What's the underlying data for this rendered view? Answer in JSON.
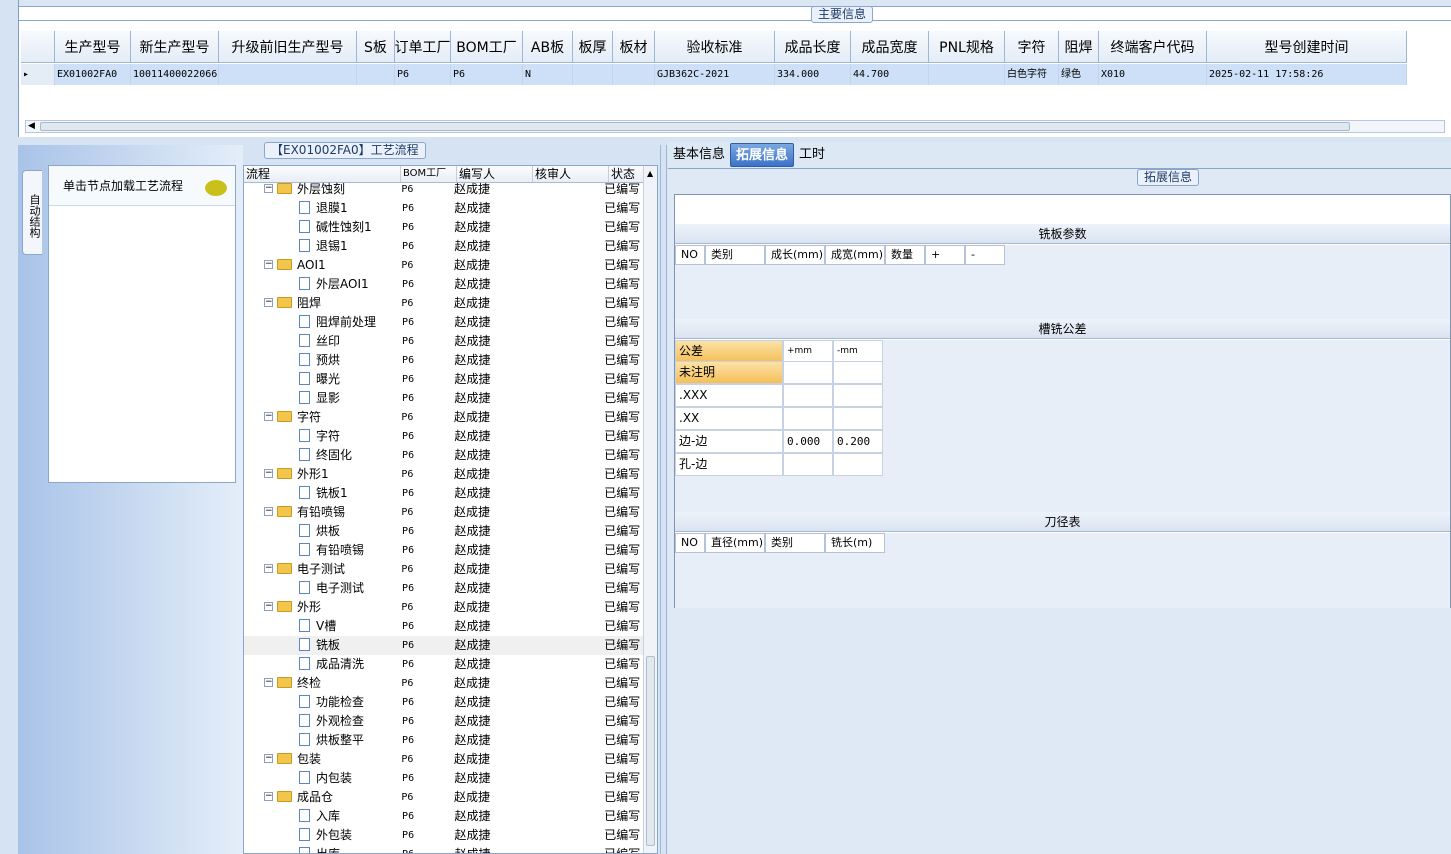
{
  "main_info": {
    "title": "主要信息",
    "columns": [
      "生产型号",
      "新生产型号",
      "升级前旧生产型号",
      "S板",
      "订单工厂",
      "BOM工厂",
      "AB板",
      "板厚",
      "板材",
      "验收标准",
      "成品长度",
      "成品宽度",
      "PNL规格",
      "字符",
      "阻焊",
      "终端客户代码",
      "型号创建时间"
    ],
    "row": [
      "EX01002FA0",
      "10011400022066",
      "",
      "",
      "P6",
      "P6",
      "N",
      "",
      "",
      "GJB362C-2021",
      "334.000",
      "44.700",
      "",
      "白色字符",
      "绿色",
      "X010",
      "2025-02-11 17:58:26"
    ]
  },
  "left_panel": {
    "side_tab": "自动结构",
    "hint": "单击节点加载工艺流程"
  },
  "process": {
    "title": "【EX01002FA0】工艺流程",
    "columns": [
      "流程",
      "BOM工厂",
      "编写人",
      "核审人",
      "状态"
    ],
    "rows": [
      {
        "name": "外层蚀刻",
        "level": 0,
        "bom": "P6",
        "writer": "赵成捷",
        "auditor": "",
        "status": "已编写"
      },
      {
        "name": "退膜1",
        "level": 1,
        "bom": "P6",
        "writer": "赵成捷",
        "auditor": "",
        "status": "已编写"
      },
      {
        "name": "碱性蚀刻1",
        "level": 1,
        "bom": "P6",
        "writer": "赵成捷",
        "auditor": "",
        "status": "已编写"
      },
      {
        "name": "退锡1",
        "level": 1,
        "bom": "P6",
        "writer": "赵成捷",
        "auditor": "",
        "status": "已编写"
      },
      {
        "name": "AOI1",
        "level": 0,
        "bom": "P6",
        "writer": "赵成捷",
        "auditor": "",
        "status": "已编写"
      },
      {
        "name": "外层AOI1",
        "level": 1,
        "bom": "P6",
        "writer": "赵成捷",
        "auditor": "",
        "status": "已编写"
      },
      {
        "name": "阻焊",
        "level": 0,
        "bom": "P6",
        "writer": "赵成捷",
        "auditor": "",
        "status": "已编写"
      },
      {
        "name": "阻焊前处理",
        "level": 1,
        "bom": "P6",
        "writer": "赵成捷",
        "auditor": "",
        "status": "已编写"
      },
      {
        "name": "丝印",
        "level": 1,
        "bom": "P6",
        "writer": "赵成捷",
        "auditor": "",
        "status": "已编写"
      },
      {
        "name": "预烘",
        "level": 1,
        "bom": "P6",
        "writer": "赵成捷",
        "auditor": "",
        "status": "已编写"
      },
      {
        "name": "曝光",
        "level": 1,
        "bom": "P6",
        "writer": "赵成捷",
        "auditor": "",
        "status": "已编写"
      },
      {
        "name": "显影",
        "level": 1,
        "bom": "P6",
        "writer": "赵成捷",
        "auditor": "",
        "status": "已编写"
      },
      {
        "name": "字符",
        "level": 0,
        "bom": "P6",
        "writer": "赵成捷",
        "auditor": "",
        "status": "已编写"
      },
      {
        "name": "字符",
        "level": 1,
        "bom": "P6",
        "writer": "赵成捷",
        "auditor": "",
        "status": "已编写"
      },
      {
        "name": "终固化",
        "level": 1,
        "bom": "P6",
        "writer": "赵成捷",
        "auditor": "",
        "status": "已编写"
      },
      {
        "name": "外形1",
        "level": 0,
        "bom": "P6",
        "writer": "赵成捷",
        "auditor": "",
        "status": "已编写"
      },
      {
        "name": "铣板1",
        "level": 1,
        "bom": "P6",
        "writer": "赵成捷",
        "auditor": "",
        "status": "已编写"
      },
      {
        "name": "有铅喷锡",
        "level": 0,
        "bom": "P6",
        "writer": "赵成捷",
        "auditor": "",
        "status": "已编写"
      },
      {
        "name": "烘板",
        "level": 1,
        "bom": "P6",
        "writer": "赵成捷",
        "auditor": "",
        "status": "已编写"
      },
      {
        "name": "有铅喷锡",
        "level": 1,
        "bom": "P6",
        "writer": "赵成捷",
        "auditor": "",
        "status": "已编写"
      },
      {
        "name": "电子测试",
        "level": 0,
        "bom": "P6",
        "writer": "赵成捷",
        "auditor": "",
        "status": "已编写"
      },
      {
        "name": "电子测试",
        "level": 1,
        "bom": "P6",
        "writer": "赵成捷",
        "auditor": "",
        "status": "已编写"
      },
      {
        "name": "外形",
        "level": 0,
        "bom": "P6",
        "writer": "赵成捷",
        "auditor": "",
        "status": "已编写"
      },
      {
        "name": "V槽",
        "level": 1,
        "bom": "P6",
        "writer": "赵成捷",
        "auditor": "",
        "status": "已编写"
      },
      {
        "name": "铣板",
        "level": 1,
        "bom": "P6",
        "writer": "赵成捷",
        "auditor": "",
        "status": "已编写",
        "selected": true
      },
      {
        "name": "成品清洗",
        "level": 1,
        "bom": "P6",
        "writer": "赵成捷",
        "auditor": "",
        "status": "已编写"
      },
      {
        "name": "终检",
        "level": 0,
        "bom": "P6",
        "writer": "赵成捷",
        "auditor": "",
        "status": "已编写"
      },
      {
        "name": "功能检查",
        "level": 1,
        "bom": "P6",
        "writer": "赵成捷",
        "auditor": "",
        "status": "已编写"
      },
      {
        "name": "外观检查",
        "level": 1,
        "bom": "P6",
        "writer": "赵成捷",
        "auditor": "",
        "status": "已编写"
      },
      {
        "name": "烘板整平",
        "level": 1,
        "bom": "P6",
        "writer": "赵成捷",
        "auditor": "",
        "status": "已编写"
      },
      {
        "name": "包装",
        "level": 0,
        "bom": "P6",
        "writer": "赵成捷",
        "auditor": "",
        "status": "已编写"
      },
      {
        "name": "内包装",
        "level": 1,
        "bom": "P6",
        "writer": "赵成捷",
        "auditor": "",
        "status": "已编写"
      },
      {
        "name": "成品仓",
        "level": 0,
        "bom": "P6",
        "writer": "赵成捷",
        "auditor": "",
        "status": "已编写"
      },
      {
        "name": "入库",
        "level": 1,
        "bom": "P6",
        "writer": "赵成捷",
        "auditor": "",
        "status": "已编写"
      },
      {
        "name": "外包装",
        "level": 1,
        "bom": "P6",
        "writer": "赵成捷",
        "auditor": "",
        "status": "已编写"
      },
      {
        "name": "出库",
        "level": 1,
        "bom": "P6",
        "writer": "赵成捷",
        "auditor": "",
        "status": "已编写"
      }
    ]
  },
  "right_panel": {
    "tabs": [
      "基本信息",
      "拓展信息",
      "工时"
    ],
    "active_tab": "拓展信息",
    "group_title": "拓展信息",
    "milling": {
      "title": "铣板参数",
      "columns": [
        "NO",
        "类别",
        "成长(mm)",
        "成宽(mm)",
        "数量",
        "+",
        "-"
      ]
    },
    "slot_tolerance": {
      "title": "槽铣公差",
      "columns": [
        "公差",
        "+mm",
        "-mm"
      ],
      "rows": [
        [
          "未注明",
          "",
          ""
        ],
        [
          ".XXX",
          "",
          ""
        ],
        [
          ".XX",
          "",
          ""
        ],
        [
          "边-边",
          "0.000",
          "0.200"
        ],
        [
          "孔-边",
          "",
          ""
        ]
      ]
    },
    "tool_table": {
      "title": "刀径表",
      "columns": [
        "NO",
        "直径(mm)",
        "类别",
        "铣长(m)"
      ]
    }
  },
  "colors": {
    "accent": "#3d73c6",
    "selection": "#cde0f7",
    "folder": "#f2c64b"
  }
}
